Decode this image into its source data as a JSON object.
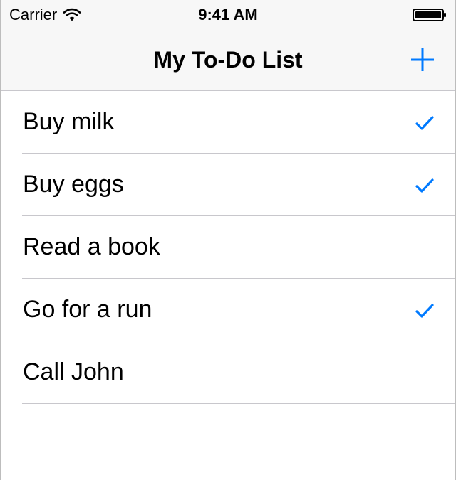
{
  "status_bar": {
    "carrier": "Carrier",
    "time": "9:41 AM",
    "wifi_icon": "wifi-icon",
    "battery_icon": "battery-icon"
  },
  "nav_bar": {
    "title": "My To-Do List",
    "add_icon": "plus-icon"
  },
  "colors": {
    "accent": "#007aff",
    "separator": "#c8c7cc",
    "bar_background": "#f7f7f7"
  },
  "todos": [
    {
      "label": "Buy milk",
      "completed": true
    },
    {
      "label": "Buy eggs",
      "completed": true
    },
    {
      "label": "Read a book",
      "completed": false
    },
    {
      "label": "Go for a run",
      "completed": true
    },
    {
      "label": "Call John",
      "completed": false
    }
  ]
}
